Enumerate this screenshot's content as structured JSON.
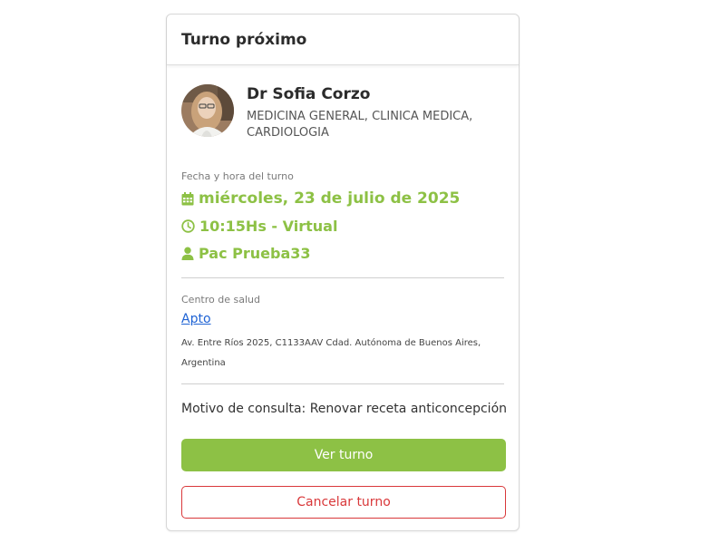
{
  "card": {
    "title": "Turno próximo"
  },
  "doctor": {
    "name": "Dr Sofia Corzo",
    "specialties": "MEDICINA GENERAL, CLINICA MEDICA, CARDIOLOGIA"
  },
  "appointment": {
    "label": "Fecha y hora del turno",
    "date": "miércoles, 23 de julio de 2025",
    "time": "10:15Hs - Virtual",
    "patient": "Pac Prueba33",
    "date_icon": "calendar-icon",
    "time_icon": "clock-icon",
    "patient_icon": "user-icon"
  },
  "center": {
    "label": "Centro de salud",
    "name": "Apto",
    "address": "Av. Entre Ríos 2025, C1133AAV Cdad. Autónoma de Buenos Aires, Argentina"
  },
  "reason": {
    "text": "Motivo de consulta: Renovar receta anticoncepción"
  },
  "actions": {
    "view_label": "Ver turno",
    "cancel_label": "Cancelar turno"
  },
  "colors": {
    "accent_green": "#8dc145",
    "danger_red": "#d9383a",
    "link_blue": "#1f63d4"
  }
}
